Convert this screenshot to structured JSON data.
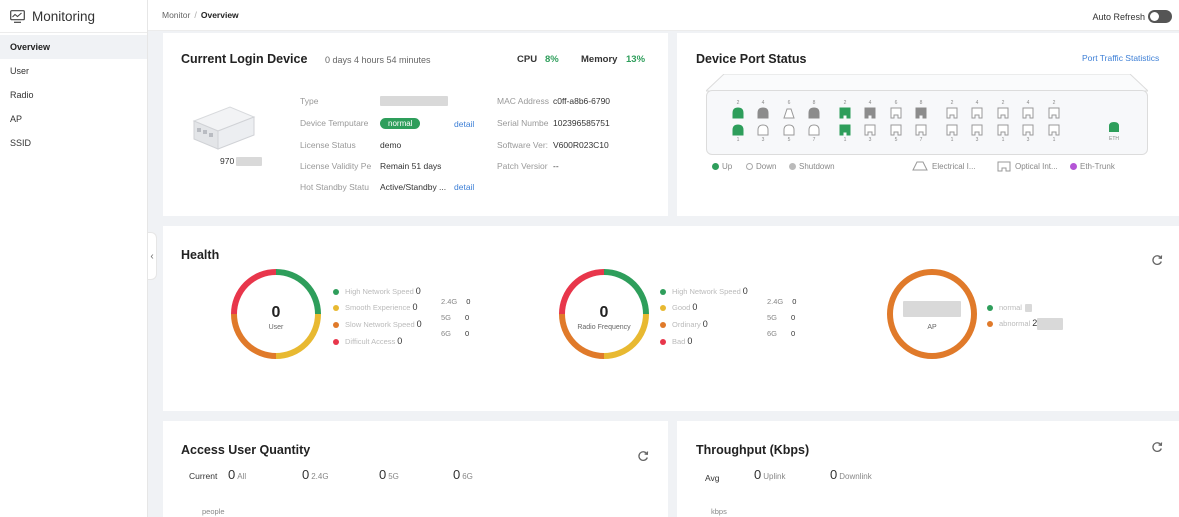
{
  "app": {
    "title": "Monitoring",
    "icon": "monitor-chart-icon"
  },
  "sidebar": {
    "items": [
      {
        "label": "Overview",
        "active": true
      },
      {
        "label": "User",
        "active": false
      },
      {
        "label": "Radio",
        "active": false
      },
      {
        "label": "AP",
        "active": false
      },
      {
        "label": "SSID",
        "active": false
      }
    ]
  },
  "breadcrumb": {
    "parent": "Monitor",
    "separator": "/",
    "current": "Overview"
  },
  "auto_refresh": {
    "label": "Auto Refresh",
    "enabled": false
  },
  "login_device": {
    "title": "Current Login Device",
    "uptime": "0 days 4 hours 54 minutes",
    "cpu_label": "CPU",
    "cpu_value": "8%",
    "memory_label": "Memory",
    "memory_value": "13%",
    "device_name": "970",
    "rows_left": [
      {
        "label": "Type",
        "value": ""
      },
      {
        "label": "Device Temputare",
        "value": "normal"
      },
      {
        "label": "License Status",
        "value": "demo"
      },
      {
        "label": "License Validity Pe",
        "value": "Remain 51 days"
      },
      {
        "label": "Hot Standby Statu",
        "value": "Active/Standby ..."
      }
    ],
    "detail_link": "detail",
    "rows_right": [
      {
        "label": "MAC Address",
        "value": "c0ff-a8b6-6790"
      },
      {
        "label": "Serial Numbe",
        "value": "102396585751"
      },
      {
        "label": "Software Ver:",
        "value": "V600R023C10"
      },
      {
        "label": "Patch Versior",
        "value": "--"
      }
    ]
  },
  "port_status": {
    "title": "Device Port Status",
    "link": "Port Traffic Statistics",
    "top_labels": [
      "2",
      "4",
      "6",
      "8",
      "2",
      "4",
      "6",
      "8",
      "2",
      "4",
      "2",
      "4",
      "2"
    ],
    "bottom_labels": [
      "1",
      "3",
      "5",
      "7",
      "1",
      "3",
      "5",
      "7",
      "1",
      "3",
      "1",
      "3",
      "1"
    ],
    "eth_label": "ETH",
    "legend": [
      {
        "label": "Up",
        "color": "#2e9e5b"
      },
      {
        "label": "Down",
        "color": "#ffffff"
      },
      {
        "label": "Shutdown",
        "color": "#bbbbbb"
      }
    ],
    "legend_types": [
      {
        "label": "Electrical I...",
        "icon": "electrical-port-icon"
      },
      {
        "label": "Optical Int...",
        "icon": "optical-port-icon"
      },
      {
        "label": "Eth-Trunk",
        "icon": "eth-trunk-dot-icon",
        "color": "#b455d6"
      }
    ]
  },
  "health": {
    "title": "Health",
    "user": {
      "value": "0",
      "label": "User",
      "legend": [
        {
          "label": "High Network Speed",
          "value": "0",
          "color": "#2e9e5b"
        },
        {
          "label": "Smooth Experience",
          "value": "0",
          "color": "#e8b931"
        },
        {
          "label": "Slow Network Speed",
          "value": "0",
          "color": "#e07a2a"
        },
        {
          "label": "Difficult Access",
          "value": "0",
          "color": "#e8364b"
        }
      ],
      "bands": [
        {
          "label": "2.4G",
          "value": "0"
        },
        {
          "label": "5G",
          "value": "0"
        },
        {
          "label": "6G",
          "value": "0"
        }
      ]
    },
    "radio": {
      "value": "0",
      "label": "Radio Frequency",
      "legend": [
        {
          "label": "High Network Speed",
          "value": "0",
          "color": "#2e9e5b"
        },
        {
          "label": "Good",
          "value": "0",
          "color": "#e8b931"
        },
        {
          "label": "Ordinary",
          "value": "0",
          "color": "#e07a2a"
        },
        {
          "label": "Bad",
          "value": "0",
          "color": "#e8364b"
        }
      ],
      "bands": [
        {
          "label": "2.4G",
          "value": "0"
        },
        {
          "label": "5G",
          "value": "0"
        },
        {
          "label": "6G",
          "value": "0"
        }
      ]
    },
    "ap": {
      "label": "AP",
      "legend": [
        {
          "label": "normal",
          "color": "#2e9e5b"
        },
        {
          "label": "abnormal",
          "value": "2",
          "color": "#e07a2a"
        }
      ]
    }
  },
  "access_users": {
    "title": "Access User Quantity",
    "current_label": "Current",
    "items": [
      {
        "value": "0",
        "unit": "All"
      },
      {
        "value": "0",
        "unit": "2.4G"
      },
      {
        "value": "0",
        "unit": "5G"
      },
      {
        "value": "0",
        "unit": "6G"
      }
    ],
    "y_unit": "people"
  },
  "throughput": {
    "title": "Throughput (Kbps)",
    "avg_label": "Avg",
    "items": [
      {
        "value": "0",
        "unit": "Uplink"
      },
      {
        "value": "0",
        "unit": "Downlink"
      }
    ],
    "y_unit": "kbps"
  }
}
